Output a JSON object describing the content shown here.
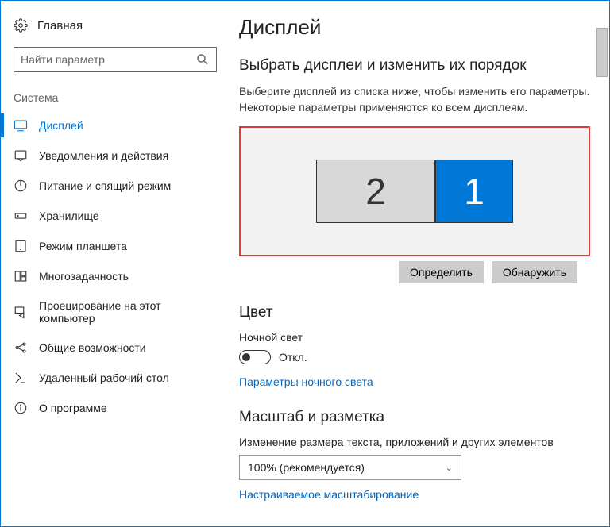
{
  "sidebar": {
    "home": "Главная",
    "search_placeholder": "Найти параметр",
    "section": "Система",
    "items": [
      {
        "label": "Дисплей"
      },
      {
        "label": "Уведомления и действия"
      },
      {
        "label": "Питание и спящий режим"
      },
      {
        "label": "Хранилище"
      },
      {
        "label": "Режим планшета"
      },
      {
        "label": "Многозадачность"
      },
      {
        "label": "Проецирование на этот компьютер"
      },
      {
        "label": "Общие возможности"
      },
      {
        "label": "Удаленный рабочий стол"
      },
      {
        "label": "О программе"
      }
    ]
  },
  "main": {
    "title": "Дисплей",
    "arrange": {
      "heading": "Выбрать дисплеи и изменить их порядок",
      "desc": "Выберите дисплей из списка ниже, чтобы изменить его параметры. Некоторые параметры применяются ко всем дисплеям.",
      "monitor2": "2",
      "monitor1": "1",
      "identify": "Определить",
      "detect": "Обнаружить"
    },
    "color": {
      "heading": "Цвет",
      "nightlight_label": "Ночной свет",
      "toggle_state": "Откл.",
      "nightlight_link": "Параметры ночного света"
    },
    "scale": {
      "heading": "Масштаб и разметка",
      "resize_label": "Изменение размера текста, приложений и других элементов",
      "value": "100% (рекомендуется)",
      "custom_link": "Настраиваемое масштабирование"
    }
  }
}
